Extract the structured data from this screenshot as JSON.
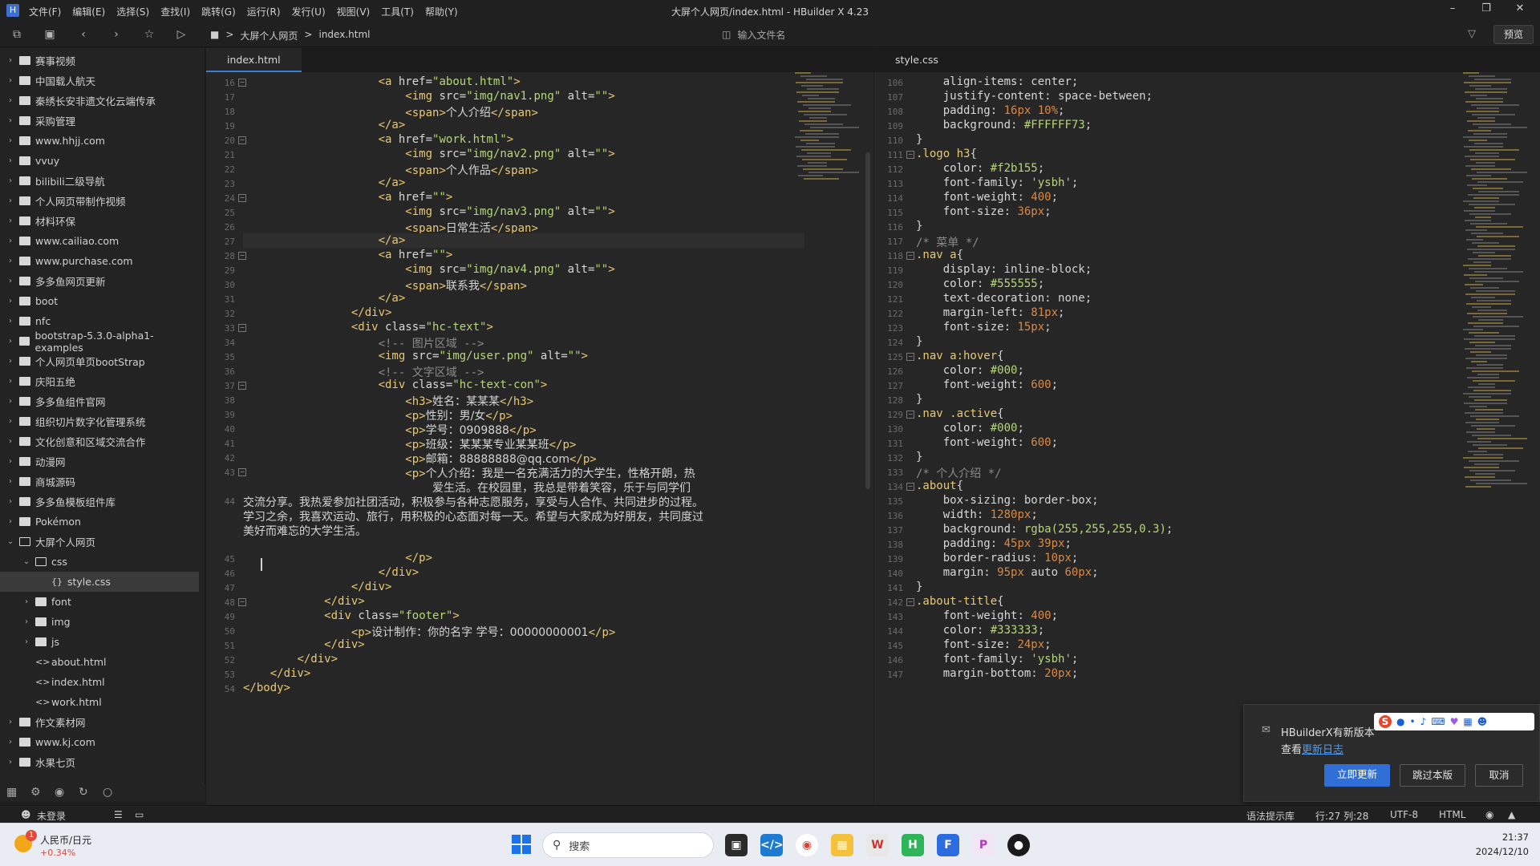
{
  "titlebar": {
    "menu": [
      "文件(F)",
      "编辑(E)",
      "选择(S)",
      "查找(I)",
      "跳转(G)",
      "运行(R)",
      "发行(U)",
      "视图(V)",
      "工具(T)",
      "帮助(Y)"
    ],
    "title": "大屏个人网页/index.html - HBuilder X 4.23"
  },
  "toolbar": {
    "breadcrumb": [
      "大屏个人网页",
      "index.html"
    ],
    "file_search_placeholder": "输入文件名",
    "preview_label": "预览"
  },
  "sidebar": {
    "items": [
      {
        "label": "赛事视频",
        "type": "folder"
      },
      {
        "label": "中国载人航天",
        "type": "folder"
      },
      {
        "label": "秦绣长安非遗文化云端传承",
        "type": "folder"
      },
      {
        "label": "采购管理",
        "type": "folder"
      },
      {
        "label": "www.hhjj.com",
        "type": "folder"
      },
      {
        "label": "vvuy",
        "type": "folder"
      },
      {
        "label": "bilibili二级导航",
        "type": "folder"
      },
      {
        "label": "个人网页带制作视频",
        "type": "folder"
      },
      {
        "label": "材料环保",
        "type": "folder"
      },
      {
        "label": "www.cailiao.com",
        "type": "folder"
      },
      {
        "label": "www.purchase.com",
        "type": "folder"
      },
      {
        "label": "多多鱼网页更新",
        "type": "folder"
      },
      {
        "label": "boot",
        "type": "folder"
      },
      {
        "label": "nfc",
        "type": "folder"
      },
      {
        "label": "bootstrap-5.3.0-alpha1-examples",
        "type": "folder"
      },
      {
        "label": "个人网页单页bootStrap",
        "type": "folder"
      },
      {
        "label": "庆阳五绝",
        "type": "folder"
      },
      {
        "label": "多多鱼组件官网",
        "type": "folder"
      },
      {
        "label": "组织切片数字化管理系统",
        "type": "folder"
      },
      {
        "label": "文化创意和区域交流合作",
        "type": "folder"
      },
      {
        "label": "动漫网",
        "type": "folder"
      },
      {
        "label": "商城源码",
        "type": "folder"
      },
      {
        "label": "多多鱼模板组件库",
        "type": "folder"
      },
      {
        "label": "Pokémon",
        "type": "folder"
      },
      {
        "label": "大屏个人网页",
        "type": "folder-open"
      },
      {
        "label": "css",
        "type": "folder-open",
        "indent": 1
      },
      {
        "label": "style.css",
        "type": "css",
        "indent": 2,
        "selected": true
      },
      {
        "label": "font",
        "type": "folder",
        "indent": 1
      },
      {
        "label": "img",
        "type": "folder",
        "indent": 1
      },
      {
        "label": "js",
        "type": "folder",
        "indent": 1
      },
      {
        "label": "about.html",
        "type": "html",
        "indent": 1
      },
      {
        "label": "index.html",
        "type": "html",
        "indent": 1
      },
      {
        "label": "work.html",
        "type": "html",
        "indent": 1
      },
      {
        "label": "作文素材网",
        "type": "folder"
      },
      {
        "label": "www.kj.com",
        "type": "folder"
      },
      {
        "label": "水果七页",
        "type": "folder"
      }
    ]
  },
  "editor_left": {
    "tab": "index.html",
    "lines": [
      {
        "n": "16",
        "html": "                    <span class='tag'>&lt;a</span> <span class='attr'>href</span>=<span class='str'>\"about.html\"</span><span class='tag'>&gt;</span>"
      },
      {
        "n": "17",
        "html": "                        <span class='tag'>&lt;img</span> <span class='attr'>src</span>=<span class='str'>\"img/nav1.png\"</span> <span class='attr'>alt</span>=<span class='str'>\"\"</span><span class='tag'>&gt;</span>"
      },
      {
        "n": "18",
        "html": "                        <span class='tag'>&lt;span&gt;</span><span class='cjk'>个人介绍</span><span class='tag'>&lt;/span&gt;</span>"
      },
      {
        "n": "19",
        "html": "                    <span class='tag'>&lt;/a&gt;</span>"
      },
      {
        "n": "20",
        "html": "                    <span class='tag'>&lt;a</span> <span class='attr'>href</span>=<span class='str'>\"work.html\"</span><span class='tag'>&gt;</span>"
      },
      {
        "n": "21",
        "html": "                        <span class='tag'>&lt;img</span> <span class='attr'>src</span>=<span class='str'>\"img/nav2.png\"</span> <span class='attr'>alt</span>=<span class='str'>\"\"</span><span class='tag'>&gt;</span>"
      },
      {
        "n": "22",
        "html": "                        <span class='tag'>&lt;span&gt;</span><span class='cjk'>个人作品</span><span class='tag'>&lt;/span&gt;</span>"
      },
      {
        "n": "23",
        "html": "                    <span class='tag'>&lt;/a&gt;</span>"
      },
      {
        "n": "24",
        "html": "                    <span class='tag'>&lt;a</span> <span class='attr'>href</span>=<span class='str'>\"\"</span><span class='tag'>&gt;</span>"
      },
      {
        "n": "25",
        "html": "                        <span class='tag'>&lt;img</span> <span class='attr'>src</span>=<span class='str'>\"img/nav3.png\"</span> <span class='attr'>alt</span>=<span class='str'>\"\"</span><span class='tag'>&gt;</span>"
      },
      {
        "n": "26",
        "html": "                        <span class='tag'>&lt;span&gt;</span><span class='cjk'>日常生活</span><span class='tag'>&lt;/span&gt;</span>"
      },
      {
        "n": "27",
        "html": "                    <span class='tag'>&lt;/a&gt;</span>",
        "hl": true
      },
      {
        "n": "28",
        "html": "                    <span class='tag'>&lt;a</span> <span class='attr'>href</span>=<span class='str'>\"\"</span><span class='tag'>&gt;</span>"
      },
      {
        "n": "29",
        "html": "                        <span class='tag'>&lt;img</span> <span class='attr'>src</span>=<span class='str'>\"img/nav4.png\"</span> <span class='attr'>alt</span>=<span class='str'>\"\"</span><span class='tag'>&gt;</span>"
      },
      {
        "n": "30",
        "html": "                        <span class='tag'>&lt;span&gt;</span><span class='cjk'>联系我</span><span class='tag'>&lt;/span&gt;</span>"
      },
      {
        "n": "31",
        "html": "                    <span class='tag'>&lt;/a&gt;</span>"
      },
      {
        "n": "32",
        "html": "                <span class='tag'>&lt;/div&gt;</span>"
      },
      {
        "n": "33",
        "html": "                <span class='tag'>&lt;div</span> <span class='attr'>class</span>=<span class='str'>\"hc-text\"</span><span class='tag'>&gt;</span>"
      },
      {
        "n": "34",
        "html": "                    <span class='cmt'>&lt;!-- <span class='cjk'>图片区域</span> --&gt;</span>"
      },
      {
        "n": "35",
        "html": "                    <span class='tag'>&lt;img</span> <span class='attr'>src</span>=<span class='str'>\"img/user.png\"</span> <span class='attr'>alt</span>=<span class='str'>\"\"</span><span class='tag'>&gt;</span>"
      },
      {
        "n": "36",
        "html": "                    <span class='cmt'>&lt;!-- <span class='cjk'>文字区域</span> --&gt;</span>"
      },
      {
        "n": "37",
        "html": "                    <span class='tag'>&lt;div</span> <span class='attr'>class</span>=<span class='str'>\"hc-text-con\"</span><span class='tag'>&gt;</span>"
      },
      {
        "n": "38",
        "html": "                        <span class='tag'>&lt;h3&gt;</span><span class='cjk'>姓名：某某某</span><span class='tag'>&lt;/h3&gt;</span>"
      },
      {
        "n": "39",
        "html": "                        <span class='tag'>&lt;p&gt;</span><span class='cjk'>性别：男/女</span><span class='tag'>&lt;/p&gt;</span>"
      },
      {
        "n": "40",
        "html": "                        <span class='tag'>&lt;p&gt;</span><span class='cjk'>学号：0909888</span><span class='tag'>&lt;/p&gt;</span>"
      },
      {
        "n": "41",
        "html": "                        <span class='tag'>&lt;p&gt;</span><span class='cjk'>班级：某某某专业某某班</span><span class='tag'>&lt;/p&gt;</span>"
      },
      {
        "n": "42",
        "html": "                        <span class='tag'>&lt;p&gt;</span><span class='cjk'>邮箱：88888888@qq.com</span><span class='tag'>&lt;/p&gt;</span>"
      },
      {
        "n": "43",
        "html": "                        <span class='tag'>&lt;p&gt;</span><span class='cjk'>个人介绍：我是一名充满活力的大学生，性格开朗，热</span>"
      },
      {
        "n": "",
        "html": "                            <span class='cjk'>爱生活。在校园里，我总是带着笑容，乐于与同学们</span>"
      },
      {
        "n": "44",
        "html": "<span class='cjk'>交流分享。我热爱参加社团活动，积极参与各种志愿服务，享受与人合作、共同进步的过程。</span>"
      },
      {
        "n": "",
        "html": "<span class='cjk'>学习之余，我喜欢运动、旅行，用积极的心态面对每一天。希望与大家成为好朋友，共同度过</span>"
      },
      {
        "n": "",
        "html": "<span class='cjk'>美好而难忘的大学生活。</span>"
      },
      {
        "n": "",
        "html": ""
      },
      {
        "n": "45",
        "html": "                        <span class='tag'>&lt;/p&gt;</span>"
      },
      {
        "n": "46",
        "html": "                    <span class='tag'>&lt;/div&gt;</span>"
      },
      {
        "n": "47",
        "html": "                <span class='tag'>&lt;/div&gt;</span>"
      },
      {
        "n": "48",
        "html": "            <span class='tag'>&lt;/div&gt;</span>"
      },
      {
        "n": "49",
        "html": "            <span class='tag'>&lt;div</span> <span class='attr'>class</span>=<span class='str'>\"footer\"</span><span class='tag'>&gt;</span>"
      },
      {
        "n": "50",
        "html": "                <span class='tag'>&lt;p&gt;</span><span class='cjk'>设计制作：你的名字 学号：00000000001</span><span class='tag'>&lt;/p&gt;</span>"
      },
      {
        "n": "51",
        "html": "            <span class='tag'>&lt;/div&gt;</span>"
      },
      {
        "n": "52",
        "html": "        <span class='tag'>&lt;/div&gt;</span>"
      },
      {
        "n": "53",
        "html": "    <span class='tag'>&lt;/div&gt;</span>"
      },
      {
        "n": "54",
        "html": "<span class='tag'>&lt;/body&gt;</span>"
      }
    ]
  },
  "editor_right": {
    "tab": "style.css",
    "lines": [
      {
        "n": "106",
        "html": "    <span class='prop'>align-items</span>: center;"
      },
      {
        "n": "107",
        "html": "    <span class='prop'>justify-content</span>: space-between;"
      },
      {
        "n": "108",
        "html": "    <span class='prop'>padding</span>: <span class='num'>16px 10%</span>;"
      },
      {
        "n": "109",
        "html": "    <span class='prop'>background</span>: <span class='col'>#FFFFFF73</span>;"
      },
      {
        "n": "110",
        "html": "}"
      },
      {
        "n": "111",
        "html": "<span class='sel-c'>.logo h3</span>{"
      },
      {
        "n": "112",
        "html": "    <span class='prop'>color</span>: <span class='col'>#f2b155</span>;"
      },
      {
        "n": "113",
        "html": "    <span class='prop'>font-family</span>: <span class='str'>'ysbh'</span>;"
      },
      {
        "n": "114",
        "html": "    <span class='prop'>font-weight</span>: <span class='num'>400</span>;"
      },
      {
        "n": "115",
        "html": "    <span class='prop'>font-size</span>: <span class='num'>36px</span>;"
      },
      {
        "n": "116",
        "html": "}"
      },
      {
        "n": "117",
        "html": "<span class='cmt'>/* <span class='cjk'>菜单</span> */</span>"
      },
      {
        "n": "118",
        "html": "<span class='sel-c'>.nav a</span>{"
      },
      {
        "n": "119",
        "html": "    <span class='prop'>display</span>: inline-block;"
      },
      {
        "n": "120",
        "html": "    <span class='prop'>color</span>: <span class='col'>#555555</span>;"
      },
      {
        "n": "121",
        "html": "    <span class='prop'>text-decoration</span>: none;"
      },
      {
        "n": "122",
        "html": "    <span class='prop'>margin-left</span>: <span class='num'>81px</span>;"
      },
      {
        "n": "123",
        "html": "    <span class='prop'>font-size</span>: <span class='num'>15px</span>;"
      },
      {
        "n": "124",
        "html": "}"
      },
      {
        "n": "125",
        "html": "<span class='sel-c'>.nav a:hover</span>{"
      },
      {
        "n": "126",
        "html": "    <span class='prop'>color</span>: <span class='col'>#000</span>;"
      },
      {
        "n": "127",
        "html": "    <span class='prop'>font-weight</span>: <span class='num'>600</span>;"
      },
      {
        "n": "128",
        "html": "}"
      },
      {
        "n": "129",
        "html": "<span class='sel-c'>.nav .active</span>{"
      },
      {
        "n": "130",
        "html": "    <span class='prop'>color</span>: <span class='col'>#000</span>;"
      },
      {
        "n": "131",
        "html": "    <span class='prop'>font-weight</span>: <span class='num'>600</span>;"
      },
      {
        "n": "132",
        "html": "}"
      },
      {
        "n": "133",
        "html": "<span class='cmt'>/* <span class='cjk'>个人介绍</span> */</span>"
      },
      {
        "n": "134",
        "html": "<span class='sel-c'>.about</span>{"
      },
      {
        "n": "135",
        "html": "    <span class='prop'>box-sizing</span>: border-box;"
      },
      {
        "n": "136",
        "html": "    <span class='prop'>width</span>: <span class='num'>1280px</span>;"
      },
      {
        "n": "137",
        "html": "    <span class='prop'>background</span>: <span class='col'>rgba(255,255,255,0.3)</span>;"
      },
      {
        "n": "138",
        "html": "    <span class='prop'>padding</span>: <span class='num'>45px 39px</span>;"
      },
      {
        "n": "139",
        "html": "    <span class='prop'>border-radius</span>: <span class='num'>10px</span>;"
      },
      {
        "n": "140",
        "html": "    <span class='prop'>margin</span>: <span class='num'>95px</span> auto <span class='num'>60px</span>;"
      },
      {
        "n": "141",
        "html": "}"
      },
      {
        "n": "142",
        "html": "<span class='sel-c'>.about-title</span>{"
      },
      {
        "n": "143",
        "html": "    <span class='prop'>font-weight</span>: <span class='num'>400</span>;"
      },
      {
        "n": "144",
        "html": "    <span class='prop'>color</span>: <span class='col'>#333333</span>;"
      },
      {
        "n": "145",
        "html": "    <span class='prop'>font-size</span>: <span class='num'>24px</span>;"
      },
      {
        "n": "146",
        "html": "    <span class='prop'>font-family</span>: <span class='str'>'ysbh'</span>;"
      },
      {
        "n": "147",
        "html": "    <span class='prop'>margin-bottom</span>: <span class='num'>20px</span>;"
      }
    ]
  },
  "statusbar": {
    "login": "未登录",
    "syntax": "语法提示库",
    "position": "行:27  列:28",
    "encoding": "UTF-8",
    "language": "HTML"
  },
  "popup": {
    "title": "HBuilderX有新版本",
    "view_prefix": "查看",
    "changelog_link": "更新日志",
    "update_btn": "立即更新",
    "skip_btn": "跳过本版",
    "cancel_btn": "取消"
  },
  "taskbar": {
    "widget_title": "人民币/日元",
    "widget_value": "+0.34%",
    "widget_badge": "1",
    "search_label": "搜索",
    "time": "21:37",
    "date": "2024/12/10"
  },
  "colors": {
    "accent": "#3a7bd5",
    "update_btn": "#2f6fd6",
    "widget_value": "#e04b3c"
  }
}
